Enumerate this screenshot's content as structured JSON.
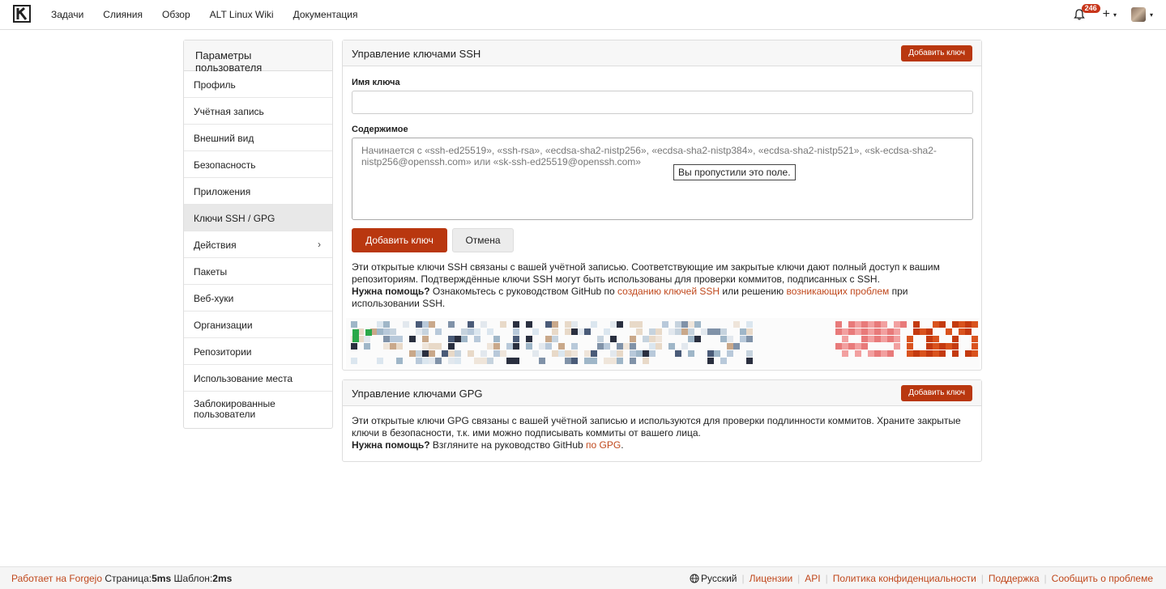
{
  "nav": {
    "items": [
      "Задачи",
      "Слияния",
      "Обзор",
      "ALT Linux Wiki",
      "Документация"
    ],
    "notification_count": "246",
    "plus": "+",
    "caret": "▾"
  },
  "sidebar": {
    "title": "Параметры пользователя",
    "items": [
      {
        "label": "Профиль"
      },
      {
        "label": "Учётная запись"
      },
      {
        "label": "Внешний вид"
      },
      {
        "label": "Безопасность"
      },
      {
        "label": "Приложения"
      },
      {
        "label": "Ключи SSH / GPG",
        "active": true
      },
      {
        "label": "Действия",
        "arrow": "›"
      },
      {
        "label": "Пакеты"
      },
      {
        "label": "Веб-хуки"
      },
      {
        "label": "Организации"
      },
      {
        "label": "Репозитории"
      },
      {
        "label": "Использование места"
      },
      {
        "label": "Заблокированные пользователи"
      }
    ]
  },
  "ssh": {
    "title": "Управление ключами SSH",
    "add_key_button": "Добавить ключ",
    "key_name_label": "Имя ключа",
    "key_name_value": "",
    "content_label": "Содержимое",
    "content_placeholder": "Начинается с «ssh-ed25519», «ssh-rsa», «ecdsa-sha2-nistp256», «ecdsa-sha2-nistp384», «ecdsa-sha2-nistp521», «sk-ecdsa-sha2-nistp256@openssh.com» или «sk-ssh-ed25519@openssh.com»",
    "tooltip": "Вы пропустили это поле.",
    "submit_button": "Добавить ключ",
    "cancel_button": "Отмена",
    "help_text": "Эти открытые ключи SSH связаны с вашей учётной записью. Соответствующие им закрытые ключи дают полный доступ к вашим репозиториям. Подтверждённые ключи SSH могут быть использованы для проверки коммитов, подписанных с SSH.",
    "help_bold": "Нужна помощь?",
    "help_prefix": " Ознакомьтесь с руководством GitHub по ",
    "help_link1": "созданию ключей SSH",
    "help_middle": " или решению ",
    "help_link2": "возникающих проблем",
    "help_suffix": " при использовании SSH."
  },
  "gpg": {
    "title": "Управление ключами GPG",
    "add_key_button": "Добавить ключ",
    "help_text": "Эти открытые ключи GPG связаны с вашей учётной записью и используются для проверки подлинности коммитов. Храните закрытые ключи в безопасности, т.к. ими можно подписывать коммиты от вашего лица.",
    "help_bold": "Нужна помощь?",
    "help_prefix": " Взгляните на руководство GitHub ",
    "help_link": "по GPG",
    "help_suffix": "."
  },
  "footer": {
    "powered_by": "Работает на Forgejo",
    "page_label": "Страница:",
    "page_time": "5ms",
    "template_label": "Шаблон:",
    "template_time": "2ms",
    "language": "Русский",
    "links": [
      "Лицензии",
      "API",
      "Политика конфиденциальности",
      "Поддержка",
      "Сообщить о проблеме"
    ]
  },
  "colors": {
    "accent": "#b9370f",
    "link": "#c0481c"
  }
}
